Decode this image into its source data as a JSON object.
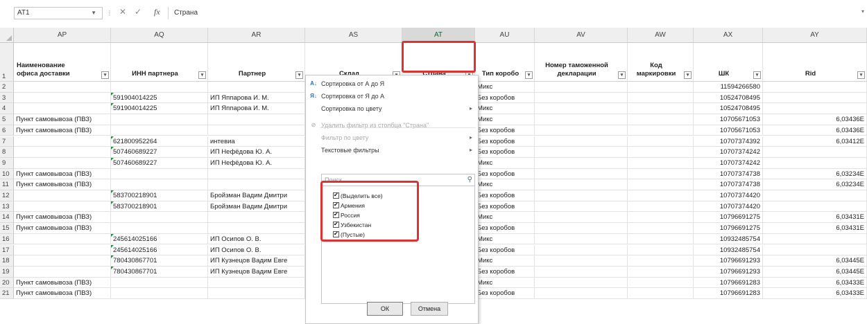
{
  "formula_bar": {
    "name_box": "AT1",
    "fx": "fx",
    "content": "Страна"
  },
  "columns": [
    {
      "letter": "AP",
      "header": "Наименование офиса доставки",
      "header_lines": [
        "Наименование",
        "офиса доставки"
      ]
    },
    {
      "letter": "AQ",
      "header": "ИНН партнера"
    },
    {
      "letter": "AR",
      "header": "Партнер"
    },
    {
      "letter": "AS",
      "header": "Склад"
    },
    {
      "letter": "AT",
      "header": "Страна"
    },
    {
      "letter": "AU",
      "header": "Тип коробо"
    },
    {
      "letter": "AV",
      "header": "Номер таможенной декларации",
      "header_lines": [
        "Номер таможенной",
        "декларации"
      ]
    },
    {
      "letter": "AW",
      "header": "Код маркировки"
    },
    {
      "letter": "AX",
      "header": "ШК"
    },
    {
      "letter": "AY",
      "header": "Rid"
    }
  ],
  "rows": [
    {
      "n": "1"
    },
    {
      "n": "2",
      "ap": "",
      "aq": "",
      "ar": "",
      "au": "Микс",
      "ax": "11594266580",
      "ay": ""
    },
    {
      "n": "3",
      "ap": "",
      "aq": "591904014225",
      "ar": "ИП Яппарова И. М.",
      "au": "Без коробов",
      "ax": "10524708495",
      "ay": ""
    },
    {
      "n": "4",
      "ap": "",
      "aq": "591904014225",
      "ar": "ИП Яппарова И. М.",
      "au": "Микс",
      "ax": "10524708495",
      "ay": ""
    },
    {
      "n": "5",
      "ap": "Пункт самовывоза (ПВЗ)",
      "aq": "",
      "ar": "",
      "au": "Микс",
      "ax": "10705671053",
      "ay": "6,03436E"
    },
    {
      "n": "6",
      "ap": "Пункт самовывоза (ПВЗ)",
      "aq": "",
      "ar": "",
      "au": "Без коробов",
      "ax": "10705671053",
      "ay": "6,03436E"
    },
    {
      "n": "7",
      "ap": "",
      "aq": "621800952264",
      "ar": "интевиа",
      "au": "Без коробов",
      "ax": "10707374392",
      "ay": "6,03412E"
    },
    {
      "n": "8",
      "ap": "",
      "aq": "507460689227",
      "ar": "ИП Нефёдова Ю. А.",
      "au": "Без коробов",
      "ax": "10707374242",
      "ay": ""
    },
    {
      "n": "9",
      "ap": "",
      "aq": "507460689227",
      "ar": "ИП Нефёдова Ю. А.",
      "au": "Микс",
      "ax": "10707374242",
      "ay": ""
    },
    {
      "n": "10",
      "ap": "Пункт самовывоза (ПВЗ)",
      "aq": "",
      "ar": "",
      "au": "Без коробов",
      "ax": "10707374738",
      "ay": "6,03234E"
    },
    {
      "n": "11",
      "ap": "Пункт самовывоза (ПВЗ)",
      "aq": "",
      "ar": "",
      "au": "Микс",
      "ax": "10707374738",
      "ay": "6,03234E"
    },
    {
      "n": "12",
      "ap": "",
      "aq": "583700218901",
      "ar": "Бройзман Вадим Дмитри",
      "au": "Без коробов",
      "ax": "10707374420",
      "ay": ""
    },
    {
      "n": "13",
      "ap": "",
      "aq": "583700218901",
      "ar": "Бройзман Вадим Дмитри",
      "au": "Без коробов",
      "ax": "10707374420",
      "ay": ""
    },
    {
      "n": "14",
      "ap": "Пункт самовывоза (ПВЗ)",
      "aq": "",
      "ar": "",
      "au": "Микс",
      "ax": "10796691275",
      "ay": "6,03431E"
    },
    {
      "n": "15",
      "ap": "Пункт самовывоза (ПВЗ)",
      "aq": "",
      "ar": "",
      "au": "Без коробов",
      "ax": "10796691275",
      "ay": "6,03431E"
    },
    {
      "n": "16",
      "ap": "",
      "aq": "245614025166",
      "ar": "ИП Осипов О. В.",
      "au": "Микс",
      "ax": "10932485754",
      "ay": ""
    },
    {
      "n": "17",
      "ap": "",
      "aq": "245614025166",
      "ar": "ИП Осипов О. В.",
      "au": "Без коробов",
      "ax": "10932485754",
      "ay": ""
    },
    {
      "n": "18",
      "ap": "",
      "aq": "780430867701",
      "ar": "ИП Кузнецов Вадим Евге",
      "au": "Микс",
      "ax": "10796691293",
      "ay": "6,03445E"
    },
    {
      "n": "19",
      "ap": "",
      "aq": "780430867701",
      "ar": "ИП Кузнецов Вадим Евге",
      "au": "Без коробов",
      "ax": "10796691293",
      "ay": "6,03445E"
    },
    {
      "n": "20",
      "ap": "Пункт самовывоза (ПВЗ)",
      "aq": "",
      "ar": "",
      "au": "Микс",
      "ax": "10796691283",
      "ay": "6,03433E"
    },
    {
      "n": "21",
      "ap": "Пункт самовывоза (ПВЗ)",
      "aq": "",
      "ar": "",
      "au": "Без коробов",
      "ax": "10796691283",
      "ay": "6,03433E"
    }
  ],
  "filter_menu": {
    "items": [
      {
        "icon": "sort-asc-icon",
        "glyph": "А↓",
        "label": "Сортировка от А до Я",
        "disabled": false,
        "submenu": false
      },
      {
        "icon": "sort-desc-icon",
        "glyph": "Я↓",
        "label": "Сортировка от Я до А",
        "disabled": false,
        "submenu": false
      },
      {
        "icon": "",
        "glyph": "",
        "label": "Сортировка по цвету",
        "disabled": false,
        "submenu": true
      },
      {
        "icon": "clear-filter-icon",
        "glyph": "⊘",
        "label": "Удалить фильтр из столбца \"Страна\"",
        "disabled": true,
        "submenu": false
      },
      {
        "icon": "",
        "glyph": "",
        "label": "Фильтр по цвету",
        "disabled": true,
        "submenu": true
      },
      {
        "icon": "",
        "glyph": "",
        "label": "Текстовые фильтры",
        "disabled": false,
        "submenu": true
      }
    ],
    "search_placeholder": "Поиск",
    "values": [
      {
        "label": "(Выделить все)",
        "checked": true
      },
      {
        "label": "Армения",
        "checked": true
      },
      {
        "label": "Россия",
        "checked": true
      },
      {
        "label": "Узбекистан",
        "checked": true
      },
      {
        "label": "(Пустые)",
        "checked": true
      }
    ],
    "ok_label": "ОК",
    "cancel_label": "Отмена"
  },
  "colors": {
    "highlight": "#e03131",
    "excel_green": "#217346"
  }
}
